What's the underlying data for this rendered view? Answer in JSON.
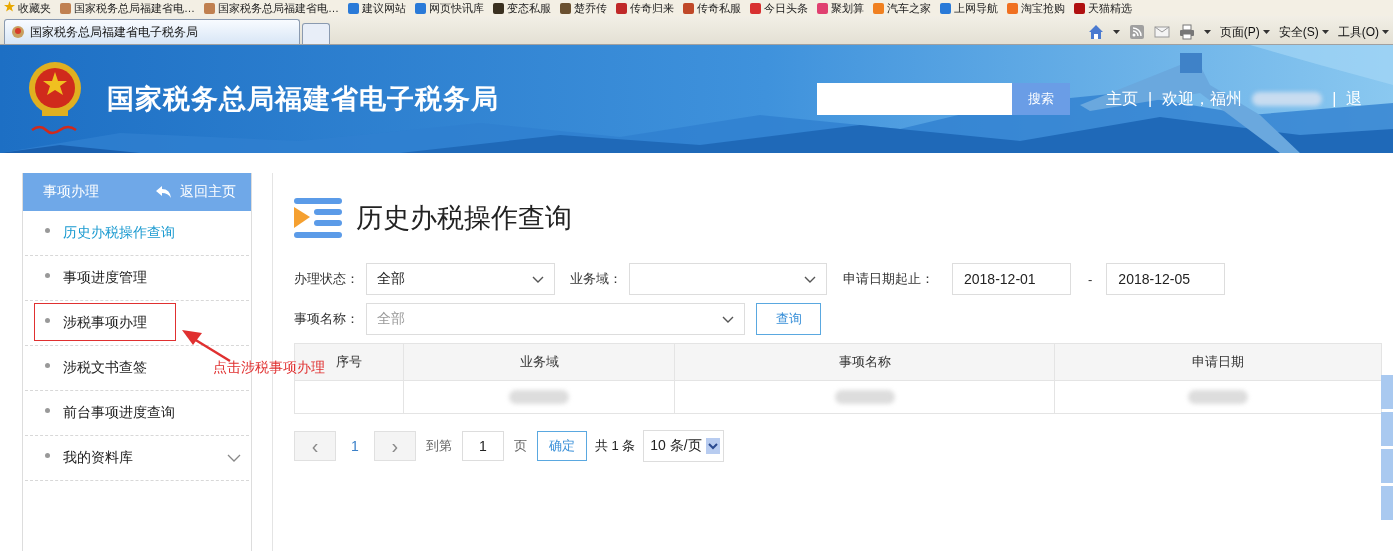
{
  "browser": {
    "favorites": "收藏夹",
    "bookmarks": [
      {
        "label": "国家税务总局福建省电…",
        "color": "#c08050"
      },
      {
        "label": "国家税务总局福建省电…",
        "color": "#c08050"
      },
      {
        "label": "建议网站",
        "color": "#2a7ad8"
      },
      {
        "label": "网页快讯库",
        "color": "#2a7ad8"
      },
      {
        "label": "变态私服",
        "color": "#3a3020"
      },
      {
        "label": "楚乔传",
        "color": "#6a5030"
      },
      {
        "label": "传奇归来",
        "color": "#c02828"
      },
      {
        "label": "传奇私服",
        "color": "#c04828"
      },
      {
        "label": "今日头条",
        "color": "#d83030"
      },
      {
        "label": "聚划算",
        "color": "#e04070"
      },
      {
        "label": "汽车之家",
        "color": "#f08020"
      },
      {
        "label": "上网导航",
        "color": "#2a7ad8"
      },
      {
        "label": "淘宝抢购",
        "color": "#f07020"
      },
      {
        "label": "天猫精选",
        "color": "#b01010"
      }
    ],
    "tab_title": "国家税务总局福建省电子税务局",
    "menus": [
      "页面(P)",
      "安全(S)",
      "工具(O)"
    ]
  },
  "header": {
    "site_title": "国家税务总局福建省电子税务局",
    "search_button": "搜索",
    "home": "主页",
    "welcome": "欢迎，福州",
    "welcome_redacted": true,
    "logout": "退",
    "separators": [
      "|",
      "|"
    ]
  },
  "sidebar": {
    "title": "事项办理",
    "back": "返回主页",
    "items": [
      {
        "label": "历史办税操作查询",
        "selected": true,
        "kind": "link",
        "annotated": false
      },
      {
        "label": "事项进度管理",
        "selected": false,
        "kind": "link",
        "annotated": false
      },
      {
        "label": "涉税事项办理",
        "selected": false,
        "kind": "link",
        "annotated": true
      },
      {
        "label": "涉税文书查签",
        "selected": false,
        "kind": "link",
        "annotated": false
      },
      {
        "label": "前台事项进度查询",
        "selected": false,
        "kind": "link",
        "annotated": false
      },
      {
        "label": "我的资料库",
        "selected": false,
        "kind": "group",
        "annotated": false
      }
    ]
  },
  "annotation": {
    "text": "点击涉税事项办理"
  },
  "main": {
    "title": "历史办税操作查询",
    "filters": {
      "status": {
        "label": "办理状态：",
        "value": "全部"
      },
      "domain": {
        "label": "业务域："
      },
      "date": {
        "label": "申请日期起止：",
        "from": "2018-12-01",
        "separator": "-",
        "to": "2018-12-05"
      },
      "name": {
        "label": "事项名称：",
        "placeholder": "全部"
      },
      "query_button": "查询"
    },
    "table": {
      "columns": [
        "序号",
        "业务域",
        "事项名称",
        "申请日期"
      ],
      "rows": [
        {
          "kind": "blurred"
        }
      ]
    },
    "pager": {
      "prev": "‹",
      "page": "1",
      "next": "›",
      "goto": "到第",
      "page_input": "1",
      "page_unit": "页",
      "confirm": "确定",
      "total": "共 1 条",
      "per_page": "10 条/页"
    }
  }
}
